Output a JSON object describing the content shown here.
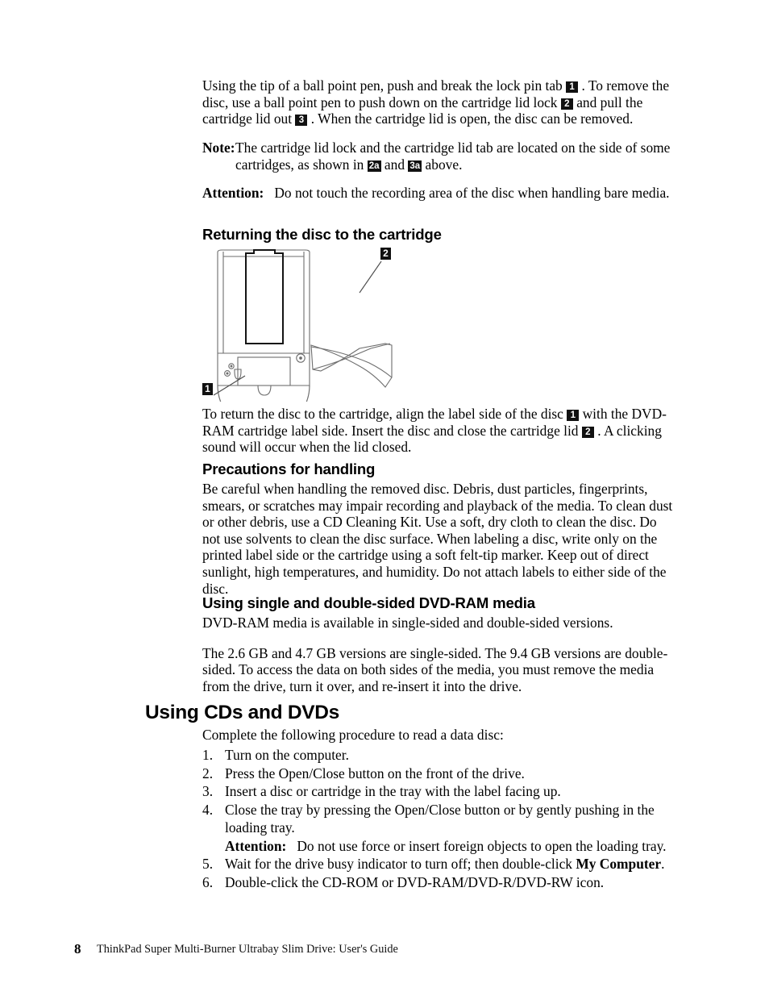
{
  "document": {
    "title": "ThinkPad Super Multi-Burner Ultrabay Slim Drive: User's Guide",
    "page_number": "8"
  },
  "intro": {
    "p1_a": "Using the tip of a ball point pen, push and break the lock pin tab",
    "p1_badge1": "1",
    "p1_b": ". To remove the disc, use a ball point pen to push down on the cartridge lid lock",
    "p1_badge2": "2",
    "p1_c": "and pull the cartridge lid out",
    "p1_badge3": "3",
    "p1_d": ". When the cartridge lid is open, the disc can be removed."
  },
  "note": {
    "label": "Note:",
    "text_a": "The cartridge lid lock and the cartridge lid tab are located on the side of some cartridges, as shown in",
    "badge_a": "2a",
    "text_b": "and",
    "badge_b": "3a",
    "text_c": "above."
  },
  "attention_top": {
    "label": "Attention:",
    "text": "Do not touch the recording area of the disc when handling bare media."
  },
  "section_returning": {
    "heading": "Returning the disc to the cartridge",
    "figure": {
      "name": "dvd-ram-cartridge-and-disc-diagram",
      "callout_disc": "1",
      "callout_lid": "2"
    },
    "p_a": "To return the disc to the cartridge, align the label side of the disc",
    "p_badge1": "1",
    "p_b": "with the DVD-RAM cartridge label side. Insert the disc and close the cartridge lid",
    "p_badge2": "2",
    "p_c": ". A clicking sound will occur when the lid closed."
  },
  "section_precautions": {
    "heading": "Precautions for handling",
    "paragraph": "Be careful when handling the removed disc. Debris, dust particles, fingerprints, smears, or scratches may impair recording and playback of the media. To clean dust or other debris, use a CD Cleaning Kit. Use a soft, dry cloth to clean the disc. Do not use solvents to clean the disc surface. When labeling a disc, write only on the printed label side or the cartridge using a soft felt-tip marker. Keep out of direct sunlight, high temperatures, and humidity. Do not attach labels to either side of the disc."
  },
  "section_media": {
    "heading": "Using single and double-sided DVD-RAM media",
    "paragraph1": "DVD-RAM media is available in single-sided and double-sided versions.",
    "paragraph2": "The 2.6 GB and 4.7 GB versions are single-sided. The 9.4 GB versions are double-sided. To access the data on both sides of the media, you must remove the media from the drive, turn it over, and re-insert it into the drive."
  },
  "section_using": {
    "heading": "Using CDs and DVDs",
    "intro": "Complete the following procedure to read a data disc:",
    "steps": [
      {
        "num": "1.",
        "text": "Turn on the computer."
      },
      {
        "num": "2.",
        "text": "Press the Open/Close button on the front of the drive."
      },
      {
        "num": "3.",
        "text": "Insert a disc or cartridge in the tray with the label facing up."
      },
      {
        "num": "4.",
        "text": "Close the tray by pressing the Open/Close button or by gently pushing in the loading tray."
      },
      {
        "num": "5.",
        "text": "Wait for the drive busy indicator to turn off; then double-click "
      },
      {
        "num": "6.",
        "text": "Double-click the CD-ROM or DVD-RAM/DVD-R/DVD-RW icon."
      }
    ],
    "step4_attention_label": "Attention:",
    "step4_attention_text": "Do not use force or insert foreign objects to open the loading tray.",
    "step5_bold": "My Computer",
    "step5_tail": "."
  },
  "colors": {
    "text": "#000000",
    "badge_bg": "#111111",
    "badge_fg": "#ffffff",
    "figure_line": "#5a5a5a",
    "figure_line_dark": "#111111"
  }
}
